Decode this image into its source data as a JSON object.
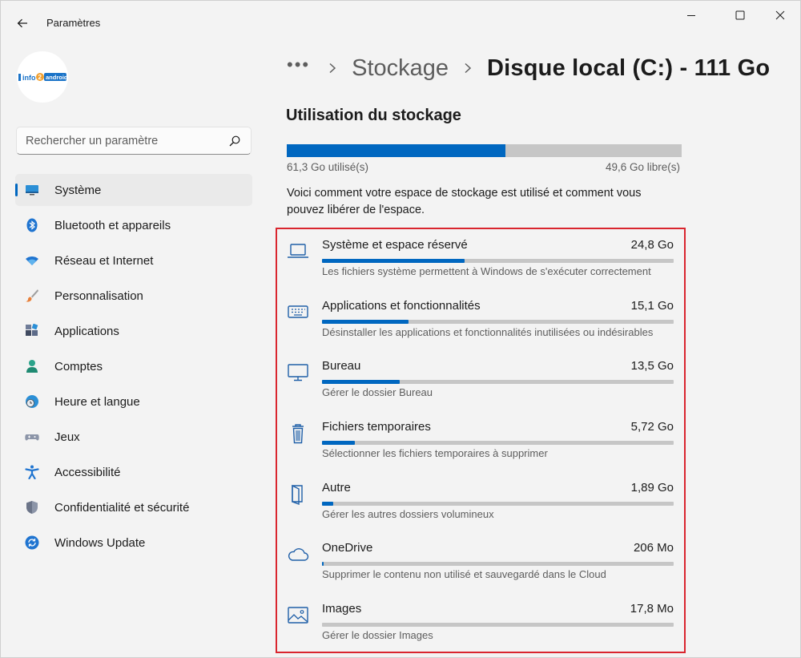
{
  "app": {
    "title": "Paramètres"
  },
  "sidebar": {
    "avatar_text": "Info2android",
    "search_placeholder": "Rechercher un paramètre",
    "items": [
      {
        "label": "Système",
        "icon": "system-icon",
        "selected": true
      },
      {
        "label": "Bluetooth et appareils",
        "icon": "bluetooth-icon"
      },
      {
        "label": "Réseau et Internet",
        "icon": "wifi-icon"
      },
      {
        "label": "Personnalisation",
        "icon": "brush-icon"
      },
      {
        "label": "Applications",
        "icon": "apps-icon"
      },
      {
        "label": "Comptes",
        "icon": "account-icon"
      },
      {
        "label": "Heure et langue",
        "icon": "clock-globe-icon"
      },
      {
        "label": "Jeux",
        "icon": "gamepad-icon"
      },
      {
        "label": "Accessibilité",
        "icon": "accessibility-icon"
      },
      {
        "label": "Confidentialité et sécurité",
        "icon": "shield-icon"
      },
      {
        "label": "Windows Update",
        "icon": "update-icon"
      }
    ]
  },
  "breadcrumb": {
    "more": "•••",
    "parent": "Stockage",
    "current": "Disque local (C:) - 111 Go"
  },
  "storage": {
    "section_title": "Utilisation du stockage",
    "used_fraction": 0.553,
    "used_label": "61,3 Go utilisé(s)",
    "free_label": "49,6 Go libre(s)",
    "description": "Voici comment votre espace de stockage est utilisé et comment vous pouvez libérer de l'espace.",
    "categories": [
      {
        "name": "Système et espace réservé",
        "size": "24,8 Go",
        "fraction": 0.405,
        "desc": "Les fichiers système permettent à Windows de s'exécuter correctement",
        "icon": "laptop-icon"
      },
      {
        "name": "Applications et fonctionnalités",
        "size": "15,1 Go",
        "fraction": 0.246,
        "desc": "Désinstaller les applications et fonctionnalités inutilisées ou indésirables",
        "icon": "keyboard-icon"
      },
      {
        "name": "Bureau",
        "size": "13,5 Go",
        "fraction": 0.22,
        "desc": "Gérer le dossier Bureau",
        "icon": "monitor-icon"
      },
      {
        "name": "Fichiers temporaires",
        "size": "5,72 Go",
        "fraction": 0.093,
        "desc": "Sélectionner les fichiers temporaires à supprimer",
        "icon": "trash-icon"
      },
      {
        "name": "Autre",
        "size": "1,89 Go",
        "fraction": 0.031,
        "desc": "Gérer les autres dossiers volumineux",
        "icon": "folder-icon"
      },
      {
        "name": "OneDrive",
        "size": "206 Mo",
        "fraction": 0.004,
        "desc": "Supprimer le contenu non utilisé et sauvegardé dans le Cloud",
        "icon": "cloud-icon"
      },
      {
        "name": "Images",
        "size": "17,8 Mo",
        "fraction": 0.0,
        "desc": "Gérer le dossier Images",
        "icon": "image-icon"
      }
    ]
  },
  "colors": {
    "accent": "#0067c0",
    "highlight": "#d9252e",
    "track": "#c6c6c6"
  }
}
